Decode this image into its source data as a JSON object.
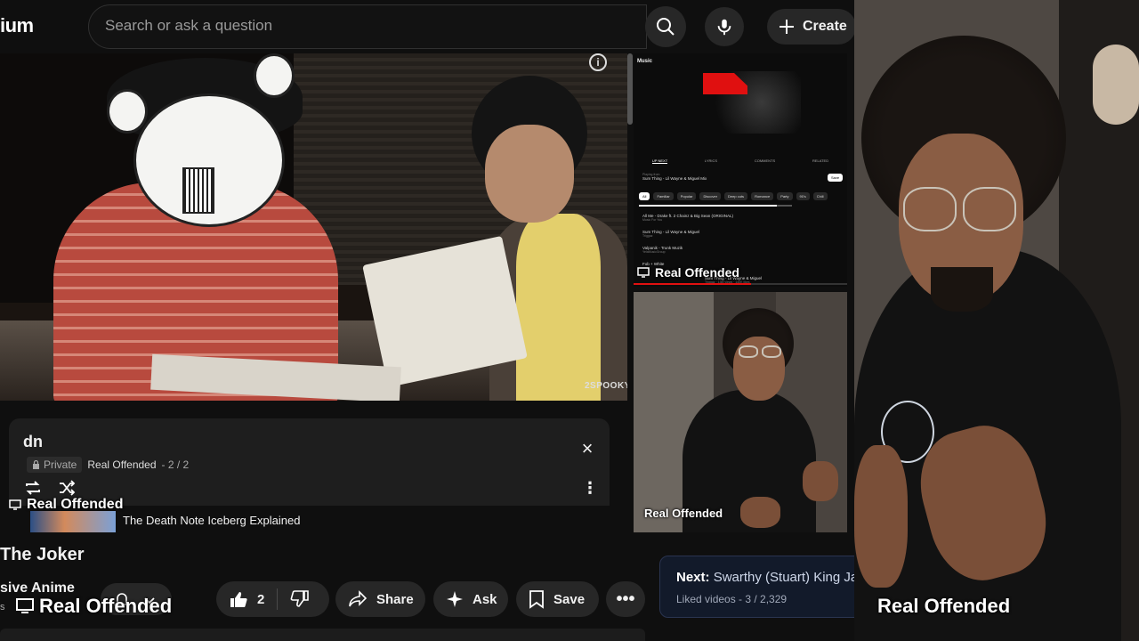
{
  "header": {
    "logo_fragment": "ium",
    "search_placeholder": "Search or ask a question",
    "search_icon": "search-icon",
    "mic_icon": "mic-icon",
    "create_label": "Create"
  },
  "video": {
    "watermark": "2SPOOKY",
    "info_icon": "info-icon"
  },
  "playlist": {
    "title": "dn",
    "privacy": "Private",
    "owner": "Real Offended",
    "position": "- 2 / 2",
    "current_item_title": "The Death Note Iceberg Explained"
  },
  "overlays": {
    "cast_label": "Real Offended"
  },
  "below_video": {
    "title": "The Joker",
    "channel_fragment": "sive Anime",
    "channel_sub": "s",
    "like_count": "2",
    "share_label": "Share",
    "ask_label": "Ask",
    "save_label": "Save"
  },
  "up_next": {
    "prefix": "Next:",
    "title": "Swarthy (Stuart) King Ja",
    "subtitle": "Liked videos - 3 / 2,329"
  },
  "mini_screen": {
    "header": "Music",
    "tabs": [
      "UP NEXT",
      "LYRICS",
      "COMMENTS",
      "RELATED"
    ],
    "now_playing_label": "Playing from",
    "now_playing": "Sum Thing - Lil Wayne & Miguel Mix",
    "save_label": "Save",
    "chips": [
      "All",
      "Familiar",
      "Popular",
      "Discover",
      "Deep cuts",
      "Romance",
      "Party",
      "90's",
      "Chill"
    ],
    "rows": [
      {
        "title": "All Me - Drake ft. 2 Chainz & Big Sean (ORIGINAL)",
        "sub": "Music For You"
      },
      {
        "title": "Sum Thing - Lil Wayne & Miguel",
        "sub": "Triggaz"
      },
      {
        "title": "Valpanik - Trunk Muzik",
        "sub": "YelaMusicGroup"
      },
      {
        "title": "Fob + White",
        "sub": ""
      }
    ],
    "footer_title": "Sum Thing - Lil Wayne & Miguel",
    "footer_sub": "Triggaz · 13M views · 140K likes",
    "progress_fraction": 0.9,
    "scrub_fraction": 0.55
  }
}
